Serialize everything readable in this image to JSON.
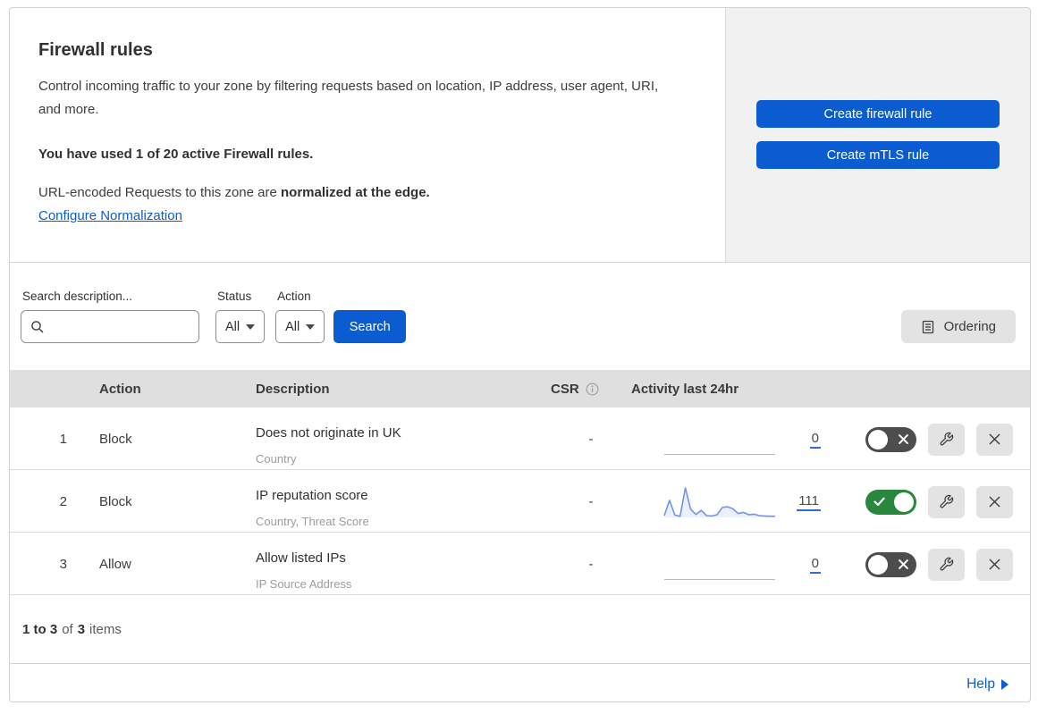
{
  "header": {
    "title": "Firewall rules",
    "description": "Control incoming traffic to your zone by filtering requests based on location, IP address, user agent, URI, and more.",
    "usage": "You have used 1 of 20 active Firewall rules.",
    "normalization_prefix": "URL-encoded Requests to this zone are",
    "normalization_bold": "normalized at the edge.",
    "normalization_link": "Configure Normalization",
    "create_firewall_button": "Create firewall rule",
    "create_mtls_button": "Create mTLS rule"
  },
  "filters": {
    "search_label": "Search description...",
    "status_label": "Status",
    "status_value": "All",
    "action_label": "Action",
    "action_value": "All",
    "search_button": "Search",
    "ordering_button": "Ordering"
  },
  "table": {
    "columns": {
      "action": "Action",
      "description": "Description",
      "csr": "CSR",
      "activity": "Activity last 24hr"
    },
    "rows": [
      {
        "index": "1",
        "action": "Block",
        "description": "Does not originate in UK",
        "fields": "Country",
        "csr": "-",
        "activity_count": "0",
        "enabled": false,
        "sparkline": []
      },
      {
        "index": "2",
        "action": "Block",
        "description": "IP reputation score",
        "fields": "Country, Threat Score",
        "csr": "-",
        "activity_count": "111",
        "enabled": true,
        "sparkline": [
          6,
          58,
          8,
          4,
          100,
          28,
          10,
          24,
          6,
          5,
          9,
          34,
          36,
          29,
          13,
          17,
          9,
          11,
          6,
          5,
          4,
          4
        ]
      },
      {
        "index": "3",
        "action": "Allow",
        "description": "Allow listed IPs",
        "fields": "IP Source Address",
        "csr": "-",
        "activity_count": "0",
        "enabled": false,
        "sparkline": []
      }
    ],
    "footer": {
      "range": "1 to 3",
      "of": "of",
      "total": "3",
      "items": "items"
    }
  },
  "help": {
    "label": "Help"
  },
  "icons": {
    "search": "magnifier-icon",
    "csr_info": "info-circle-icon",
    "ordering": "document-lines-icon",
    "edit": "wrench-icon",
    "delete": "x-icon",
    "toggle_on_mark": "check-icon",
    "toggle_off_mark": "x-icon",
    "help_arrow": "triangle-right-icon"
  },
  "colors": {
    "primary_blue": "#0b5cd1",
    "link_blue": "#0b5cd1",
    "toggle_on_green": "#28873c",
    "toggle_off_gray": "#4d4d4d",
    "sparkline_blue": "#6f97e8",
    "sparkline_fill": "rgba(110,150,235,0.14)",
    "count_underline_blue": "#2f6bd8",
    "table_header_bg": "#dfdfdf",
    "side_panel_bg": "#f1f1f2"
  }
}
